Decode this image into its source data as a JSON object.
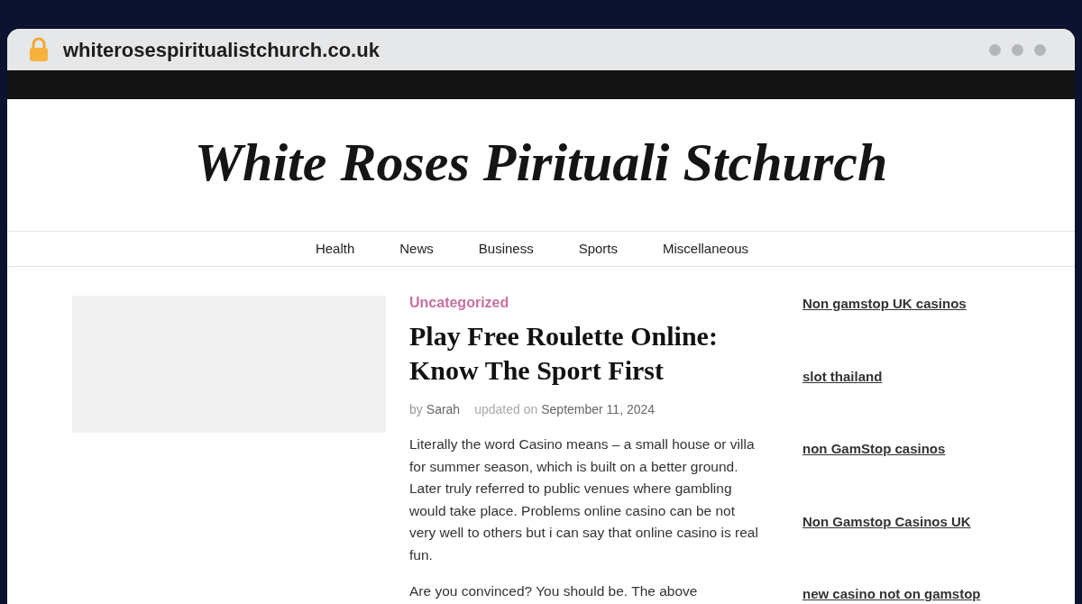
{
  "browser": {
    "url": "whiterosespiritualistchurch.co.uk"
  },
  "site": {
    "title": "White Roses Pirituali Stchurch"
  },
  "nav": [
    "Health",
    "News",
    "Business",
    "Sports",
    "Miscellaneous"
  ],
  "post": {
    "category": "Uncategorized",
    "title": "Play Free Roulette Online: Know The Sport First",
    "by": "by",
    "author": "Sarah",
    "updated": "updated on",
    "date": "September 11, 2024",
    "paragraphs": [
      "Literally the word Casino means – a small house or villa for summer season, which is built on a better ground. Later truly referred to public venues where gambling would take place. Problems online casino can be not very well to others but i can say that online casino is real fun.",
      "Are you convinced? You should be. The above"
    ]
  },
  "sidebar": [
    "Non gamstop UK casinos",
    "slot thailand",
    "non GamStop casinos",
    "Non Gamstop Casinos UK",
    "new casino not on gamstop"
  ]
}
